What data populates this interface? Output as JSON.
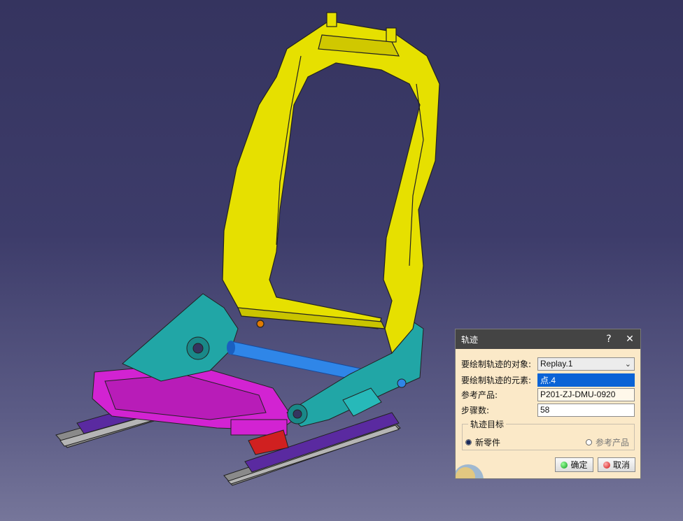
{
  "dialog": {
    "title": "轨迹",
    "help_label": "?",
    "close_label": "✕",
    "fields": {
      "object_label": "要绘制轨迹的对象:",
      "object_value": "Replay.1",
      "element_label": "要绘制轨迹的元素:",
      "element_value": "点.4",
      "ref_label": "参考产品:",
      "ref_value": "P201-ZJ-DMU-0920",
      "steps_label": "步骤数:",
      "steps_value": "58"
    },
    "group": {
      "legend": "轨迹目标",
      "opt_new": "新零件",
      "opt_ref": "参考产品"
    },
    "ok_label": "确定",
    "cancel_label": "取消"
  },
  "colors": {
    "background_top": "#35345f",
    "frame_yellow": "#e6e000",
    "cyan": "#21a6a6",
    "magenta": "#d223d2",
    "tube_blue": "#2f86e8",
    "rail_purple": "#5a2aa0",
    "rail_gray": "#8a8a8a"
  }
}
